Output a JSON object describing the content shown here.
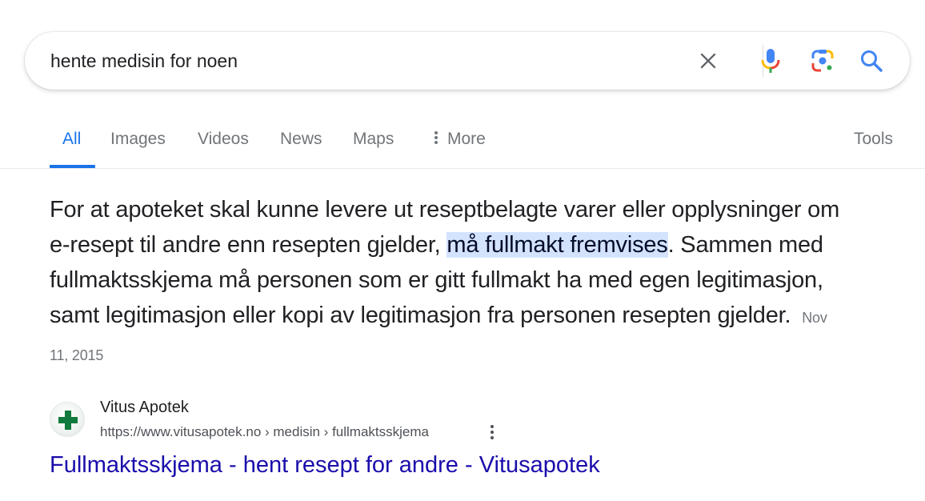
{
  "search": {
    "query": "hente medisin for noen",
    "clear_icon": "close-icon",
    "voice_icon": "microphone-icon",
    "lens_icon": "google-lens-icon",
    "submit_icon": "search-icon"
  },
  "tabs": {
    "items": [
      {
        "label": "All",
        "active": true
      },
      {
        "label": "Images",
        "active": false
      },
      {
        "label": "Videos",
        "active": false
      },
      {
        "label": "News",
        "active": false
      },
      {
        "label": "Maps",
        "active": false
      },
      {
        "label": "More",
        "active": false,
        "icon": "more-vert-icon"
      }
    ],
    "tools_label": "Tools",
    "accent_color": "#1a73e8"
  },
  "featured_snippet": {
    "text_before": "For at apoteket skal kunne levere ut reseptbelagte varer eller opplysninger om e-resept til andre enn resepten gjelder, ",
    "highlight": "må fullmakt fremvises",
    "text_after": ". Sammen med fullmaktsskjema må personen som er gitt fullmakt ha med egen legitimasjon, samt legitimasjon eller kopi av legitimasjon fra personen resepten gjelder.",
    "date": "Nov 11, 2015",
    "highlight_color": "#d3e3fd"
  },
  "source": {
    "favicon": "green-cross-icon",
    "site_name": "Vitus Apotek",
    "url": "https://www.vitusapotek.no › medisin › fullmaktsskjema",
    "menu_icon": "more-vert-icon",
    "title": "Fullmaktsskjema - hent resept for andre - Vitusapotek",
    "title_color": "#1a0dab"
  }
}
